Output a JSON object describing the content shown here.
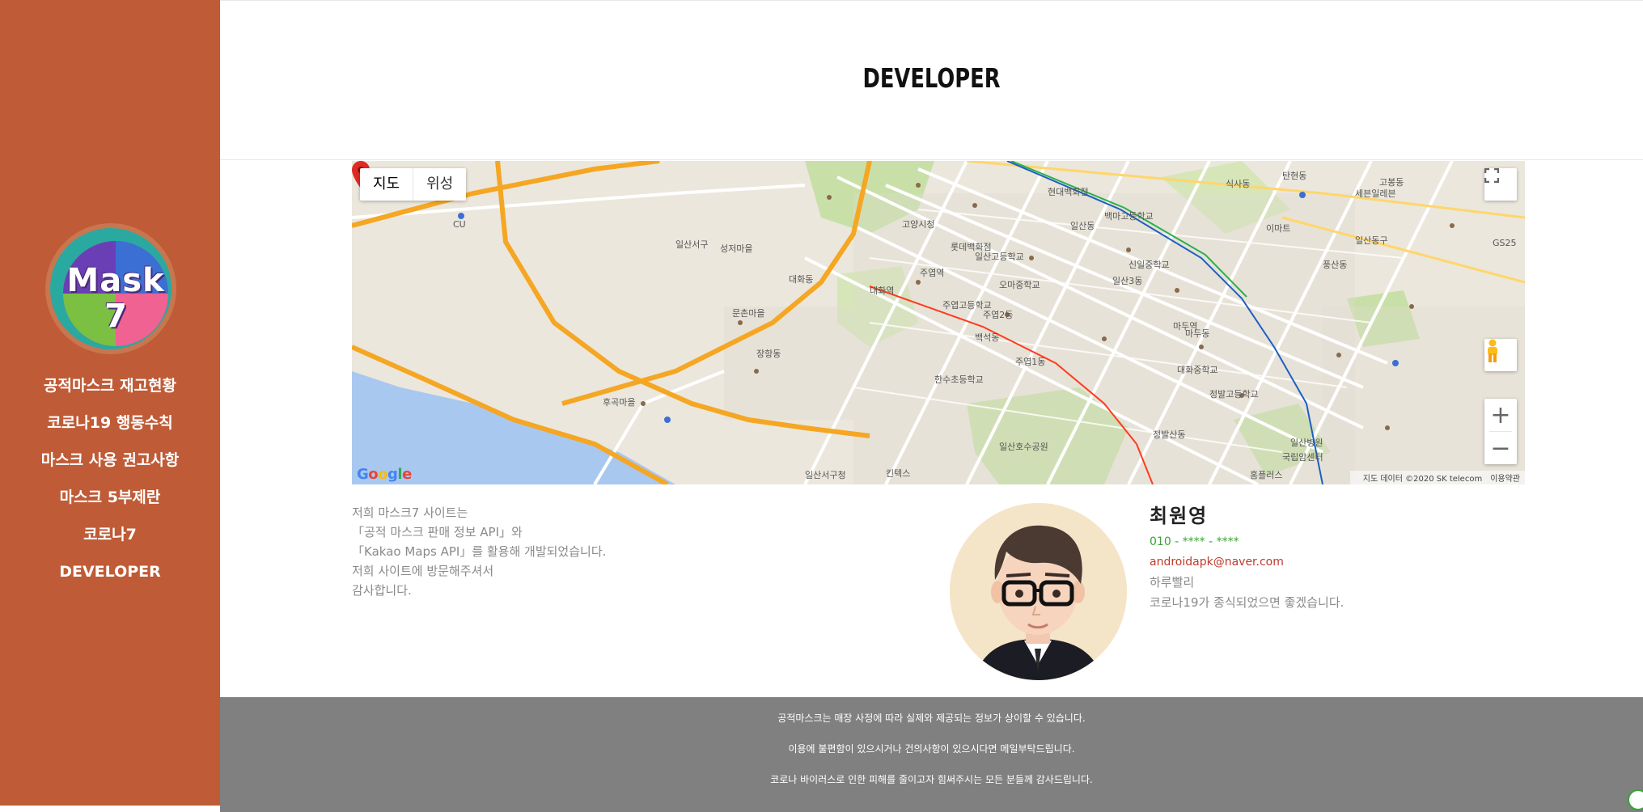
{
  "sidebar": {
    "logo": {
      "line1": "Mask",
      "line2": "7"
    },
    "nav": [
      {
        "label": "공적마스크 재고현황"
      },
      {
        "label": "코로나19 행동수칙"
      },
      {
        "label": "마스크 사용 권고사항"
      },
      {
        "label": "마스크 5부제란"
      },
      {
        "label": "코로나7"
      },
      {
        "label": "DEVELOPER"
      }
    ]
  },
  "header": {
    "title": "DEVELOPER"
  },
  "map": {
    "type_buttons": [
      "지도",
      "위성"
    ],
    "active_type": "지도",
    "zoom_in": "+",
    "zoom_out": "−",
    "google": "Google",
    "attribution": [
      "지도 데이터 ©2020 SK telecom",
      "이용약관"
    ],
    "labels": [
      "일산서구",
      "일산동구",
      "대화동",
      "주엽1동",
      "주엽2동",
      "장항동",
      "마두동",
      "일산동",
      "탄현동",
      "고봉동",
      "백석동",
      "식사동",
      "풍산동",
      "일산3동",
      "정발산동",
      "대화역",
      "주엽역",
      "마두역",
      "킨텍스",
      "일산호수공원",
      "고양시청",
      "일산병원",
      "국립암센터",
      "CU",
      "GS25",
      "세븐일레븐",
      "홈플러스",
      "이마트",
      "롯데백화점",
      "현대백화점",
      "일산서구청",
      "대화중학교",
      "주엽고등학교",
      "한수초등학교",
      "오마중학교",
      "신일중학교",
      "백마고등학교",
      "정발고등학교",
      "일산고등학교",
      "성저마을",
      "문촌마을",
      "후곡마을"
    ],
    "colors": {
      "water": "#a9c8f0",
      "highway": "#f5a623",
      "park": "#c8e0a8",
      "road": "#ffffff",
      "subway_line": "#ff3b1f"
    }
  },
  "intro": {
    "lines": [
      "저희 마스크7 사이트는",
      "「공적 마스크 판매 정보 API」와",
      "「Kakao Maps API」를 활용해 개발되었습니다.",
      "저희 사이트에 방문해주셔서",
      "감사합니다."
    ]
  },
  "profile": {
    "name": "최원영",
    "phone": "010 - **** - ****",
    "email": "androidapk@naver.com",
    "line1": "하루빨리",
    "line2": "코로나19가 종식되었으면 좋겠습니다."
  },
  "footer": {
    "lines": [
      "공적마스크는 매장 사정에 따라 실제와 제공되는 정보가 상이할 수 있습니다.",
      "이용에 불편함이 있으시거나 건의사항이 있으시다면 메일부탁드립니다.",
      "코로나 바이러스로 인한 피해를 줄이고자 힘써주시는 모든 분들께 감사드립니다."
    ]
  }
}
